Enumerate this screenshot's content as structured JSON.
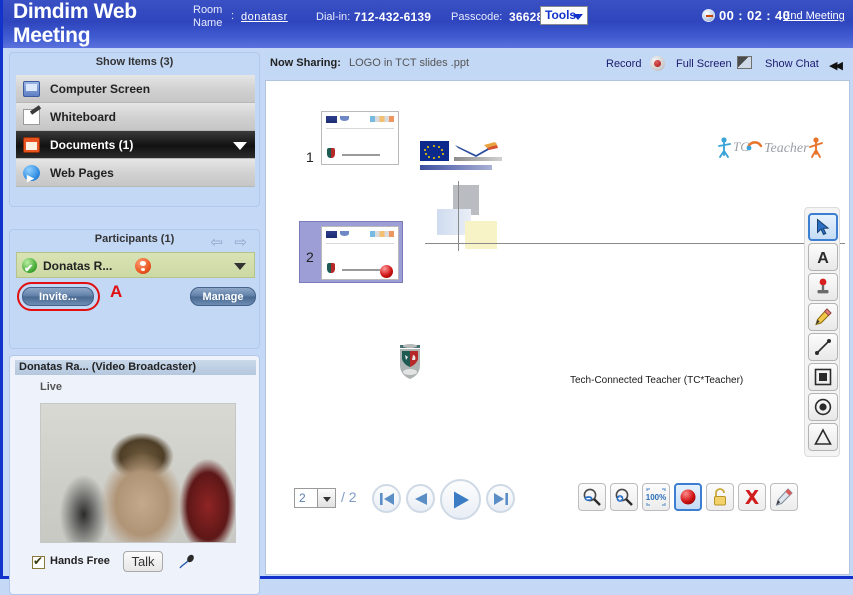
{
  "header": {
    "app_title": "Dimdim Web Meeting",
    "room_name_label": "Room Name",
    "room_colon": ":",
    "room_name_value": "donatasr",
    "dialin_label": "Dial-in:",
    "dialin_value": "712-432-6139",
    "passcode_label": "Passcode:",
    "passcode_value": "366282",
    "tools_label": "Tools",
    "timer": "00 : 02 : 40",
    "end_meeting": "End Meeting"
  },
  "sidebar": {
    "show_items": {
      "title": "Show Items (3)",
      "items": [
        {
          "label": "Computer Screen",
          "icon": "monitor-icon",
          "active": false
        },
        {
          "label": "Whiteboard",
          "icon": "whiteboard-icon",
          "active": false
        },
        {
          "label": "Documents (1)",
          "icon": "documents-icon",
          "active": true
        },
        {
          "label": "Web Pages",
          "icon": "web-pages-icon",
          "active": false
        }
      ]
    },
    "participants": {
      "title": "Participants (1)",
      "row_name": "Donatas R...",
      "invite_label": "Invite...",
      "manage_label": "Manage",
      "annotation": "A"
    },
    "video": {
      "title": "Donatas Ra... (Video Broadcaster)",
      "live_label": "Live",
      "hands_free_label": "Hands Free",
      "talk_label": "Talk"
    }
  },
  "main": {
    "now_sharing_label": "Now Sharing:",
    "now_sharing_value": "LOGO in TCT slides .ppt",
    "record_label": "Record",
    "fullscreen_label": "Full Screen",
    "show_chat_label": "Show Chat",
    "thumbnails": [
      {
        "number": "1",
        "selected": false
      },
      {
        "number": "2",
        "selected": true
      }
    ],
    "slide": {
      "caption": "Tech-Connected Teacher (TC*Teacher)"
    },
    "tool_palette": [
      {
        "name": "pointer-tool",
        "selected": true
      },
      {
        "name": "text-tool",
        "selected": false
      },
      {
        "name": "stamp-tool",
        "selected": false
      },
      {
        "name": "pencil-tool",
        "selected": false
      },
      {
        "name": "line-tool",
        "selected": false
      },
      {
        "name": "rectangle-tool",
        "selected": false
      },
      {
        "name": "circle-tool",
        "selected": false
      },
      {
        "name": "triangle-tool",
        "selected": false
      }
    ],
    "navigation": {
      "current_page": "2",
      "total_pages": "/ 2"
    },
    "bottom_tools": [
      {
        "name": "zoom-out-tool",
        "selected": false
      },
      {
        "name": "zoom-in-tool",
        "selected": false
      },
      {
        "name": "zoom-100-tool",
        "label": "100%",
        "selected": false
      },
      {
        "name": "record-tool",
        "selected": true
      },
      {
        "name": "lock-tool",
        "selected": false
      },
      {
        "name": "delete-tool",
        "selected": false
      },
      {
        "name": "annotate-tool",
        "selected": false
      }
    ]
  },
  "colors": {
    "header_blue": "#2f45bd",
    "panel_blue": "#c3d8f5",
    "accent_red": "#e01010",
    "participant_green": "#ccd9a4",
    "link_blue": "#1a1a6e"
  }
}
